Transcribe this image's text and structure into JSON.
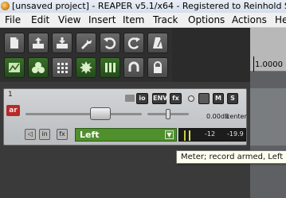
{
  "window": {
    "title": "[unsaved project] - REAPER v5.1/x64 - Registered to Reinhold S"
  },
  "menu": [
    "File",
    "Edit",
    "View",
    "Insert",
    "Item",
    "Track",
    "Options",
    "Actions",
    "He"
  ],
  "toolbar": {
    "row1": [
      "new-project-icon",
      "open-project-icon",
      "save-project-icon",
      "project-settings-icon",
      "undo-icon",
      "redo-icon",
      "metronome-icon"
    ],
    "row2": [
      "envelope-toggle-icon",
      "ripple-edit-icon",
      "grid-snap-icon",
      "item-grouping-icon",
      "locking-icon",
      "loop-icon",
      "lock-icon"
    ]
  },
  "track": {
    "number": "1",
    "arm_label": "ar",
    "buttons": {
      "io": "io",
      "env": "ENV",
      "fx": "fx",
      "mute": "M",
      "solo": "S"
    },
    "volume": "0.00dB",
    "pan": "center",
    "monitor_label": "◁",
    "input_label": "in",
    "fx_small": "fx",
    "input_name": "Left",
    "meter_peak_left": "-12",
    "meter_peak_right": "-19.9"
  },
  "ruler": {
    "position": "1.0000"
  },
  "tooltip": "Meter; record armed, Left",
  "colors": {
    "accent_green": "#4f8f2c",
    "record_arm": "#b62a2a",
    "meter_tick": "#c2d23c"
  }
}
